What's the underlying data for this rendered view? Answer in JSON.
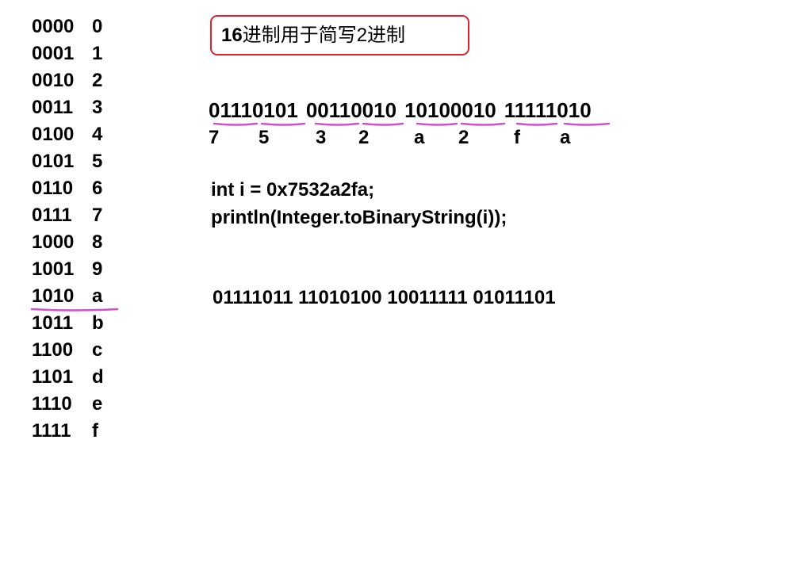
{
  "hex_table": [
    {
      "bin": "0000",
      "hex": "0"
    },
    {
      "bin": "0001",
      "hex": "1"
    },
    {
      "bin": "0010",
      "hex": "2"
    },
    {
      "bin": "0011",
      "hex": "3"
    },
    {
      "bin": "0100",
      "hex": "4"
    },
    {
      "bin": "0101",
      "hex": "5"
    },
    {
      "bin": "0110",
      "hex": "6"
    },
    {
      "bin": "0111",
      "hex": "7"
    },
    {
      "bin": "1000",
      "hex": "8"
    },
    {
      "bin": "1001",
      "hex": "9"
    },
    {
      "bin": "1010",
      "hex": "a"
    },
    {
      "bin": "1011",
      "hex": "b"
    },
    {
      "bin": "1100",
      "hex": "c"
    },
    {
      "bin": "1101",
      "hex": "d"
    },
    {
      "bin": "1110",
      "hex": "e"
    },
    {
      "bin": "1111",
      "hex": "f"
    }
  ],
  "title": {
    "prefix": "16",
    "text": "进制用于简写2进制"
  },
  "binary_bytes": [
    "01110101",
    "00110010",
    "10100010",
    "11111010"
  ],
  "hex_digits": [
    "7",
    "5",
    "3",
    "2",
    "a",
    "2",
    "f",
    "a"
  ],
  "code": {
    "line1": "int i = 0x7532a2fa;",
    "line2": "println(Integer.toBinaryString(i));"
  },
  "result": "01111011 11010100 10011111 01011101",
  "colors": {
    "underline": "#d14fd1",
    "box_border": "#e0202c"
  }
}
